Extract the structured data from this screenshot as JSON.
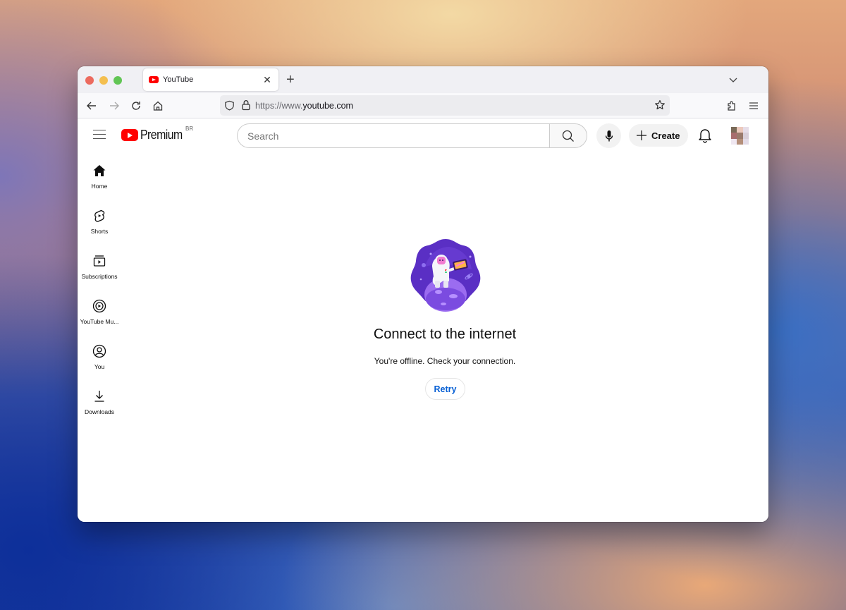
{
  "browser": {
    "tab": {
      "title": "YouTube",
      "favicon": "youtube-icon"
    },
    "url": {
      "prefix": "https://www.",
      "domain": "youtube.com"
    }
  },
  "masthead": {
    "logo_text": "Premium",
    "region_badge": "BR",
    "search_placeholder": "Search",
    "search_value": "",
    "create_label": "Create"
  },
  "sidebar": {
    "items": [
      {
        "label": "Home",
        "icon": "home-icon"
      },
      {
        "label": "Shorts",
        "icon": "shorts-icon"
      },
      {
        "label": "Subscriptions",
        "icon": "subscriptions-icon"
      },
      {
        "label": "YouTube Mu...",
        "icon": "youtube-music-icon"
      },
      {
        "label": "You",
        "icon": "you-icon"
      },
      {
        "label": "Downloads",
        "icon": "downloads-icon"
      }
    ]
  },
  "error": {
    "title": "Connect to the internet",
    "message": "You're offline. Check your connection.",
    "retry_label": "Retry"
  },
  "colors": {
    "brand_red": "#ff0000",
    "link_blue": "#065fd4",
    "illustration_purple": "#6a3fd6"
  }
}
